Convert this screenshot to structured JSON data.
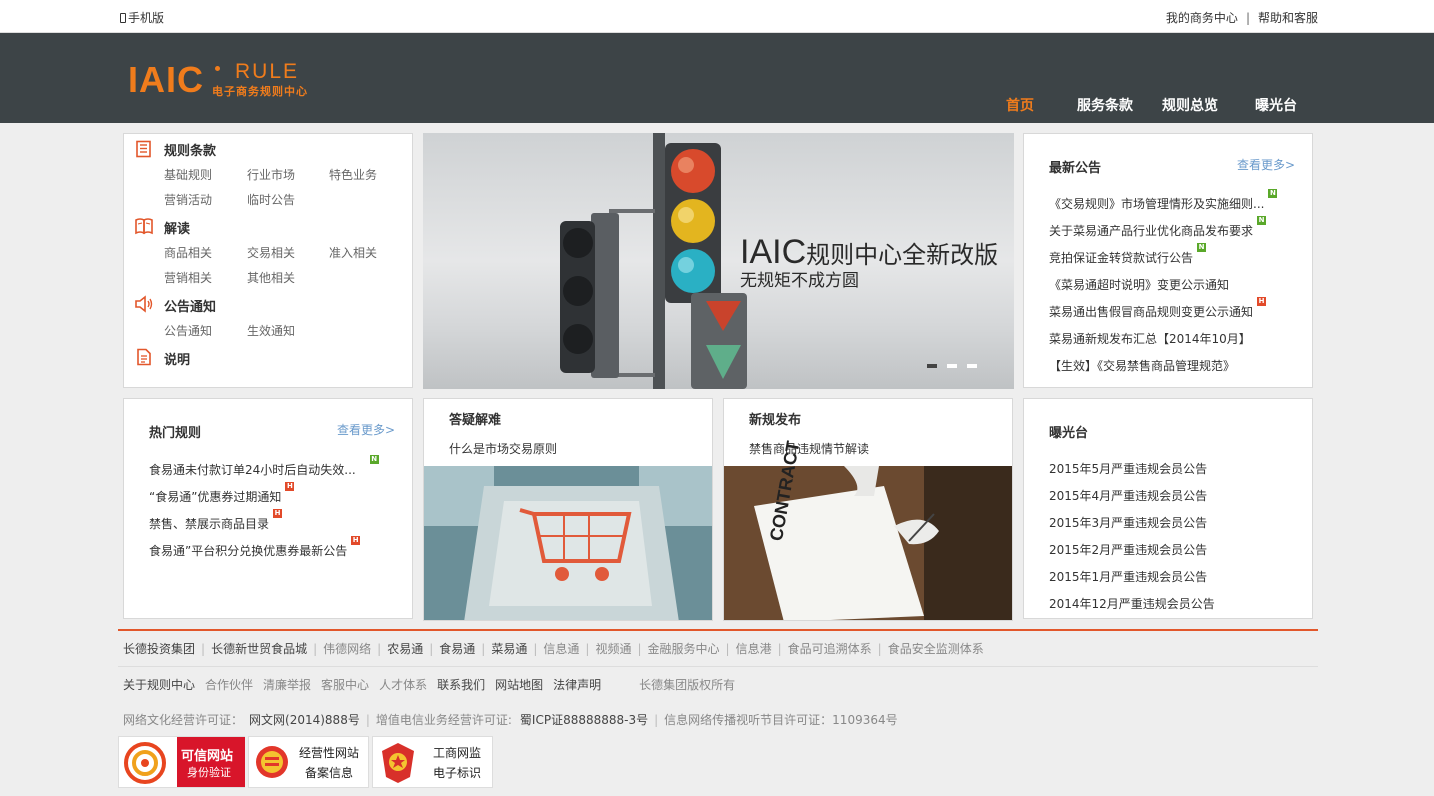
{
  "topbar": {
    "mobile_label": "手机版",
    "my_business": "我的商务中心",
    "help": "帮助和客服"
  },
  "logo": {
    "main": "IAIC",
    "rule": "RULE",
    "cn": "电子商务规则中心"
  },
  "nav": [
    {
      "label": "首页"
    },
    {
      "label": "服务条款"
    },
    {
      "label": "规则总览"
    },
    {
      "label": "曝光台"
    }
  ],
  "sidebar": {
    "sections": [
      {
        "title": "规则条款",
        "icon": "book-icon",
        "items": [
          "基础规则",
          "行业市场",
          "特色业务",
          "营销活动",
          "临时公告"
        ]
      },
      {
        "title": "解读",
        "icon": "open-book-icon",
        "items": [
          "商品相关",
          "交易相关",
          "准入相关",
          "营销相关",
          "其他相关"
        ]
      },
      {
        "title": "公告通知",
        "icon": "speaker-icon",
        "items": [
          "公告通知",
          "生效通知"
        ]
      },
      {
        "title": "说明",
        "icon": "document-icon",
        "items": []
      }
    ]
  },
  "banner": {
    "title_brand": "IAIC",
    "title_rest": "规则中心全新改版",
    "subtitle": "无规矩不成方圆"
  },
  "announcements": {
    "title": "最新公告",
    "more": "查看更多>",
    "items": [
      {
        "text": "《交易规则》市场管理情形及实施细则...",
        "badge": "N"
      },
      {
        "text": "关于菜易通产品行业优化商品发布要求",
        "badge": "N"
      },
      {
        "text": "竞拍保证金转贷款试行公告",
        "badge": "N"
      },
      {
        "text": "《菜易通超时说明》变更公示通知",
        "badge": ""
      },
      {
        "text": "菜易通出售假冒商品规则变更公示通知",
        "badge": "H"
      },
      {
        "text": "菜易通新规发布汇总【2014年10月】",
        "badge": ""
      },
      {
        "text": "【生效】《交易禁售商品管理规范》",
        "badge": ""
      }
    ]
  },
  "hot_rules": {
    "title": "热门规则",
    "more": "查看更多>",
    "items": [
      {
        "text": "食易通未付款订单24小时后自动失效...",
        "badge": "N"
      },
      {
        "text": "“食易通”优惠券过期通知",
        "badge": "H"
      },
      {
        "text": "禁售、禁展示商品目录",
        "badge": "H"
      },
      {
        "text": "食易通”平台积分兑换优惠券最新公告",
        "badge": "H"
      }
    ]
  },
  "qa": {
    "title": "答疑解难",
    "text": "什么是市场交易原则"
  },
  "new_rules": {
    "title": "新规发布",
    "text": "禁售商品违规情节解读",
    "doc_label": "CONTRACT"
  },
  "exposure": {
    "title": "曝光台",
    "items": [
      "2015年5月严重违规会员公告",
      "2015年4月严重违规会员公告",
      "2015年3月严重违规会员公告",
      "2015年2月严重违规会员公告",
      "2015年1月严重违规会员公告",
      "2014年12月严重违规会员公告"
    ]
  },
  "footer": {
    "partners": [
      {
        "label": "长德投资集团",
        "dark": true
      },
      {
        "label": "长德新世贸食品城",
        "dark": true
      },
      {
        "label": "伟德网络",
        "dark": false
      },
      {
        "label": "农易通",
        "dark": true
      },
      {
        "label": "食易通",
        "dark": true
      },
      {
        "label": "菜易通",
        "dark": true
      },
      {
        "label": "信息通",
        "dark": false
      },
      {
        "label": "视频通",
        "dark": false
      },
      {
        "label": "金融服务中心",
        "dark": false
      },
      {
        "label": "信息港",
        "dark": false
      },
      {
        "label": "食品可追溯体系",
        "dark": false
      },
      {
        "label": "食品安全监测体系",
        "dark": false
      }
    ],
    "links": [
      {
        "label": "关于规则中心",
        "dark": true
      },
      {
        "label": "合作伙伴",
        "dark": false
      },
      {
        "label": "清廉举报",
        "dark": false
      },
      {
        "label": "客服中心",
        "dark": false
      },
      {
        "label": "人才体系",
        "dark": false
      },
      {
        "label": "联系我们",
        "dark": true
      },
      {
        "label": "网站地图",
        "dark": true
      },
      {
        "label": "法律声明",
        "dark": true
      }
    ],
    "copyright": "长德集团版权所有",
    "license_1_label": "网络文化经营许可证：",
    "license_1_value": "网文网(2014)888号",
    "license_2_label": "增值电信业务经营许可证:",
    "license_2_value": "蜀ICP证88888888-3号",
    "license_3": "信息网络传播视听节目许可证：1109364号",
    "badges": {
      "trusted_1": "可信网站",
      "trusted_2": "身份验证",
      "biz_1": "经营性网站",
      "biz_2": "备案信息",
      "aic_1": "工商网监",
      "aic_2": "电子标识"
    }
  }
}
